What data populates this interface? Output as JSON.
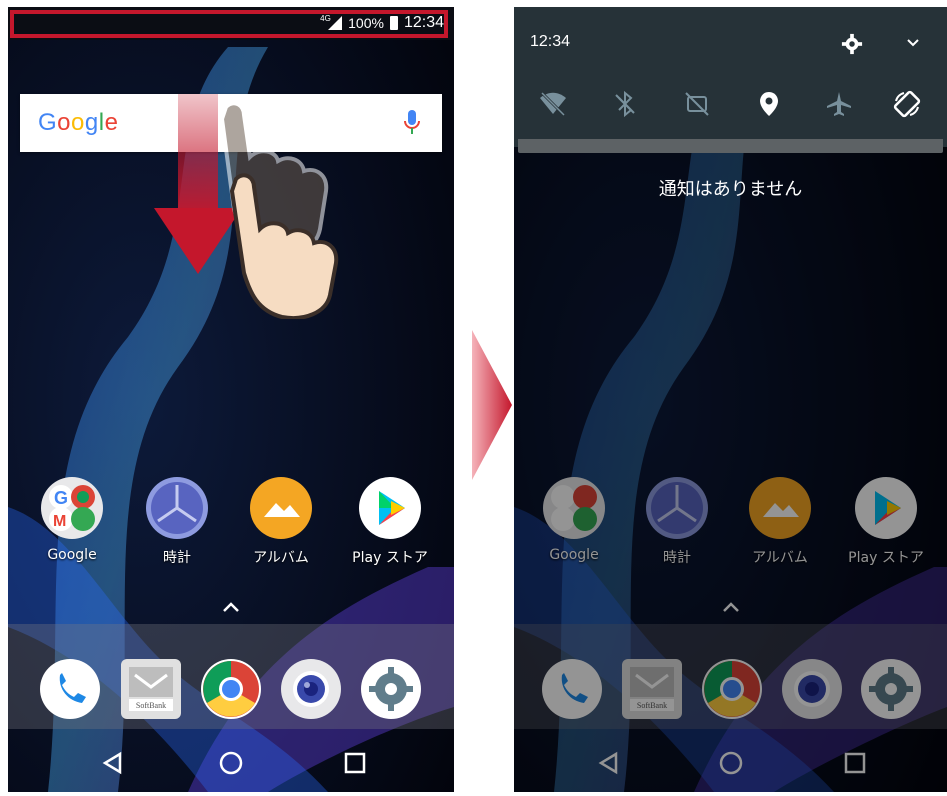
{
  "left": {
    "status": {
      "network": "4G",
      "battery": "100%",
      "time": "12:34"
    },
    "search": {
      "logo": "Google"
    },
    "apps": [
      {
        "label": "Google"
      },
      {
        "label": "時計"
      },
      {
        "label": "アルバム"
      },
      {
        "label": "Play ストア"
      }
    ],
    "dock": [
      {
        "icon": "phone-icon"
      },
      {
        "icon": "softbank-mail-icon",
        "text": "SoftBank"
      },
      {
        "icon": "chrome-icon"
      },
      {
        "icon": "camera-icon"
      },
      {
        "icon": "settings-icon"
      }
    ]
  },
  "right": {
    "shade": {
      "time": "12:34",
      "quick_settings": [
        "wifi-off-icon",
        "bluetooth-off-icon",
        "dnd-icon",
        "location-icon",
        "airplane-icon",
        "auto-rotate-icon"
      ],
      "empty_message": "通知はありません"
    },
    "apps": [
      {
        "label": "Google"
      },
      {
        "label": "時計"
      },
      {
        "label": "アルバム"
      },
      {
        "label": "Play ストア"
      }
    ]
  },
  "colors": {
    "highlight": "#c4172c",
    "shade": "#263238"
  }
}
